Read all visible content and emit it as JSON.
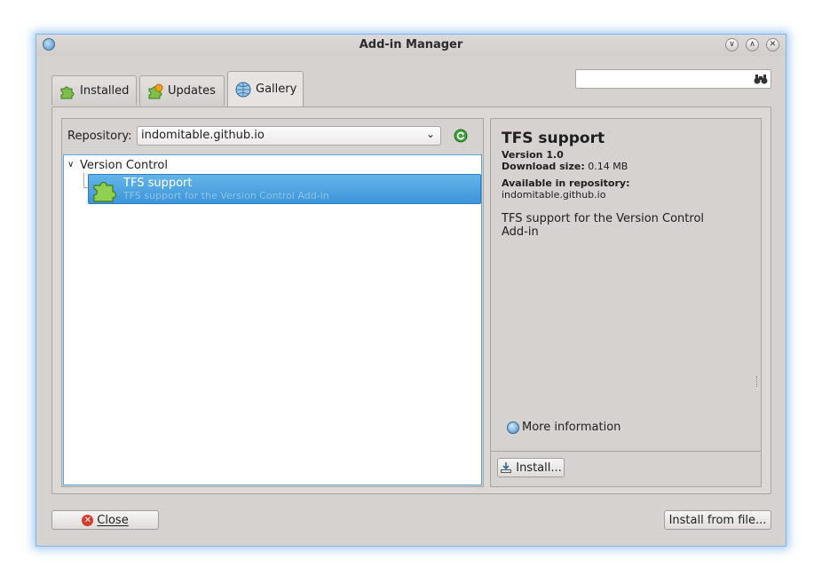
{
  "window": {
    "title": "Add-in Manager"
  },
  "tabs": [
    {
      "label": "Installed",
      "icon": "puzzle-icon"
    },
    {
      "label": "Updates",
      "icon": "puzzle-update-icon"
    },
    {
      "label": "Gallery",
      "icon": "globe-icon",
      "selected": true
    }
  ],
  "search": {
    "value": "",
    "icon": "binoculars-icon"
  },
  "repository": {
    "label": "Repository:",
    "selected": "indomitable.github.io"
  },
  "tree": {
    "group": "Version Control",
    "items": [
      {
        "name": "TFS support",
        "description": "TFS support for the Version Control Add-in",
        "selected": true
      }
    ]
  },
  "details": {
    "title": "TFS support",
    "version_label": "Version 1.0",
    "download_label": "Download size:",
    "download_value": "0.14 MB",
    "repo_label": "Available in repository:",
    "repo_value": "indomitable.github.io",
    "description": "TFS support for the Version Control Add-in",
    "more_info": "More information",
    "install": "Install..."
  },
  "footer": {
    "close": "Close",
    "install_from_file": "Install from file..."
  },
  "colors": {
    "selection": "#3d95d8",
    "focus_border": "#5aa5dc",
    "window_bg": "#d6d2d0"
  }
}
